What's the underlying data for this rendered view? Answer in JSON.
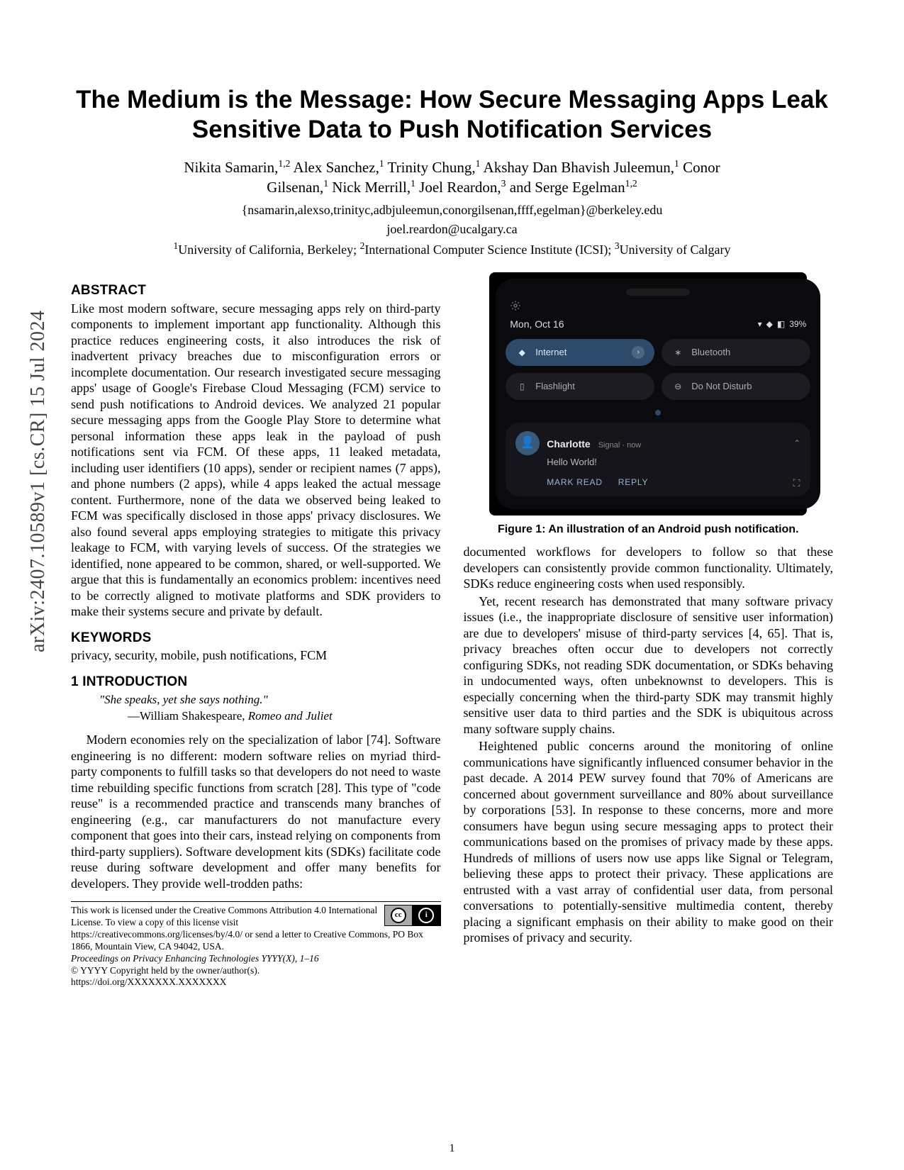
{
  "arxiv_stamp": "arXiv:2407.10589v1  [cs.CR]  15 Jul 2024",
  "title": "The Medium is the Message: How Secure Messaging Apps Leak Sensitive Data to Push Notification Services",
  "authors_line1": "Nikita Samarin,",
  "authors_sup1a": "1,2",
  "authors_line1b": " Alex Sanchez,",
  "authors_sup1b": "1",
  "authors_line1c": " Trinity Chung,",
  "authors_sup1c": "1",
  "authors_line1d": " Akshay Dan Bhavish Juleemun,",
  "authors_sup1d": "1",
  "authors_line1e": " Conor",
  "authors_line2a": "Gilsenan,",
  "authors_sup2a": "1",
  "authors_line2b": " Nick Merrill,",
  "authors_sup2b": "1",
  "authors_line2c": " Joel Reardon,",
  "authors_sup2c": "3",
  "authors_line2d": " and Serge Egelman",
  "authors_sup2d": "1,2",
  "email1": "{nsamarin,alexso,trinityc,adbjuleemun,conorgilsenan,ffff,egelman}@berkeley.edu",
  "email2": "joel.reardon@ucalgary.ca",
  "affiliations": "1University of California, Berkeley; 2International Computer Science Institute (ICSI); 3University of Calgary",
  "aff1sup": "1",
  "aff1": "University of California, Berkeley; ",
  "aff2sup": "2",
  "aff2": "International Computer Science Institute (ICSI); ",
  "aff3sup": "3",
  "aff3": "University of Calgary",
  "sec_abstract": "ABSTRACT",
  "abstract": "Like most modern software, secure messaging apps rely on third-party components to implement important app functionality. Although this practice reduces engineering costs, it also introduces the risk of inadvertent privacy breaches due to misconfiguration errors or incomplete documentation. Our research investigated secure messaging apps' usage of Google's Firebase Cloud Messaging (FCM) service to send push notifications to Android devices. We analyzed 21 popular secure messaging apps from the Google Play Store to determine what personal information these apps leak in the payload of push notifications sent via FCM. Of these apps, 11 leaked metadata, including user identifiers (10 apps), sender or recipient names (7 apps), and phone numbers (2 apps), while 4 apps leaked the actual message content. Furthermore, none of the data we observed being leaked to FCM was specifically disclosed in those apps' privacy disclosures. We also found several apps employing strategies to mitigate this privacy leakage to FCM, with varying levels of success. Of the strategies we identified, none appeared to be common, shared, or well-supported. We argue that this is fundamentally an economics problem: incentives need to be correctly aligned to motivate platforms and SDK providers to make their systems secure and private by default.",
  "sec_keywords": "KEYWORDS",
  "keywords": "privacy, security, mobile, push notifications, FCM",
  "sec_intro": "1   INTRODUCTION",
  "quote": "\"She speaks, yet she says nothing.\"",
  "quote_attrib_pre": "—William Shakespeare, ",
  "quote_attrib_em": "Romeo and Juliet",
  "intro_p1": "Modern economies rely on the specialization of labor [74]. Software engineering is no different: modern software relies on myriad third-party components to fulfill tasks so that developers do not need to waste time rebuilding specific functions from scratch [28]. This type of \"code reuse\" is a recommended practice and transcends many branches of engineering (e.g., car manufacturers do not manufacture every component that goes into their cars, instead relying on components from third-party suppliers). Software development kits (SDKs) facilitate code reuse during software development and offer many benefits for developers. They provide well-trodden paths:",
  "license": {
    "line1": "This work is licensed under the Creative Commons Attribution 4.0 International License. To view a copy of this license visit https://creativecommons.org/licenses/by/4.0/ or send a letter to Creative Commons, PO Box 1866, Mountain View, CA 94042, USA.",
    "line2_em": "Proceedings on Privacy Enhancing Technologies YYYY(X), 1–16",
    "line3": "© YYYY Copyright held by the owner/author(s).",
    "line4": "https://doi.org/XXXXXXX.XXXXXXX",
    "cc_left": "cc",
    "cc_right": "i"
  },
  "figure1_caption": "Figure 1: An illustration of an Android push notification.",
  "col2_p1": "documented workflows for developers to follow so that these developers can consistently provide common functionality. Ultimately, SDKs reduce engineering costs when used responsibly.",
  "col2_p2": "Yet, recent research has demonstrated that many software privacy issues (i.e., the inappropriate disclosure of sensitive user information) are due to developers' misuse of third-party services [4, 65]. That is, privacy breaches often occur due to developers not correctly configuring SDKs, not reading SDK documentation, or SDKs behaving in undocumented ways, often unbeknownst to developers. This is especially concerning when the third-party SDK may transmit highly sensitive user data to third parties and the SDK is ubiquitous across many software supply chains.",
  "col2_p3": "Heightened public concerns around the monitoring of online communications have significantly influenced consumer behavior in the past decade. A 2014 PEW survey found that 70% of Americans are concerned about government surveillance and 80% about surveillance by corporations [53]. In response to these concerns, more and more consumers have begun using secure messaging apps to protect their communications based on the promises of privacy made by these apps. Hundreds of millions of users now use apps like Signal or Telegram, believing these apps to protect their privacy. These applications are entrusted with a vast array of confidential user data, from personal conversations to potentially-sensitive multimedia content, thereby placing a significant emphasis on their ability to make good on their promises of privacy and security.",
  "phone": {
    "date": "Mon, Oct 16",
    "battery": "39%",
    "tiles": {
      "internet": "Internet",
      "bluetooth": "Bluetooth",
      "flashlight": "Flashlight",
      "dnd": "Do Not Disturb"
    },
    "notif": {
      "sender": "Charlotte",
      "source": "Signal · now",
      "body": "Hello World!",
      "action1": "MARK READ",
      "action2": "REPLY"
    }
  },
  "page_number": "1"
}
